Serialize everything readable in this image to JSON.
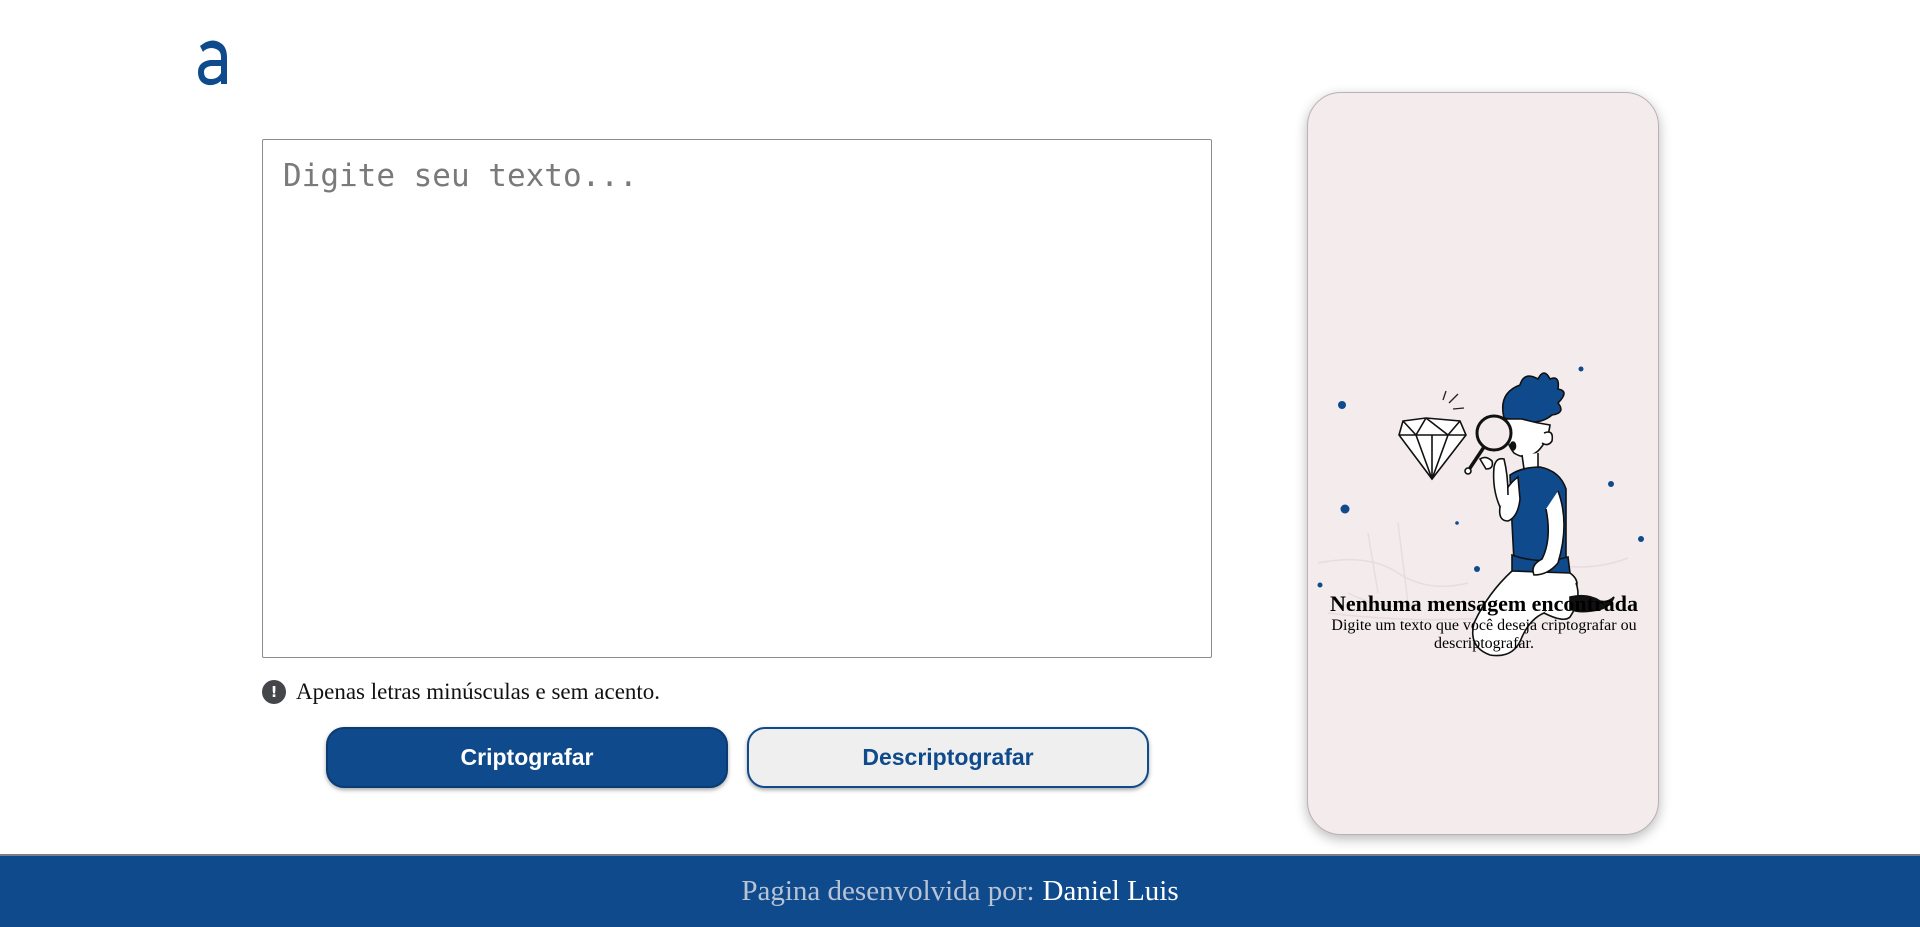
{
  "header": {
    "logo_icon": "alura-a-logo-icon"
  },
  "input": {
    "placeholder": "Digite seu texto...",
    "value": ""
  },
  "hint": {
    "icon": "exclamation-circle-icon",
    "text": "Apenas letras minúsculas e sem acento."
  },
  "buttons": {
    "encrypt_label": "Criptografar",
    "decrypt_label": "Descriptografar"
  },
  "result": {
    "illustration_icon": "person-inspecting-diamond-illustration",
    "title": "Nenhuma mensagem encontrada",
    "subtitle": "Digite um texto que você deseja criptografar ou descriptografar."
  },
  "footer": {
    "prefix": "Pagina desenvolvida por:",
    "author": "Daniel Luis"
  },
  "colors": {
    "primary": "#0e4a8c",
    "card_background": "#f4ecec",
    "secondary_button_background": "#efefef"
  }
}
